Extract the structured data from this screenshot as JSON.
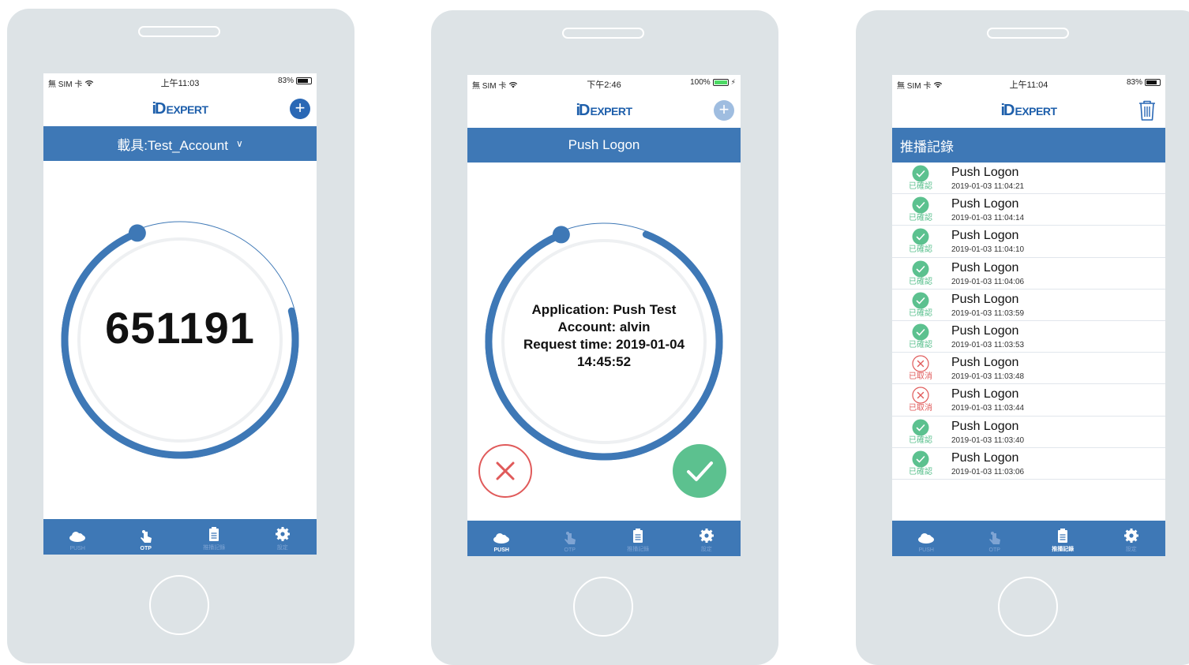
{
  "colors": {
    "brand": "#3e78b6",
    "approve": "#5cc18f",
    "reject": "#e05a5a"
  },
  "phones": [
    {
      "status": {
        "carrier": "無 SIM 卡",
        "time": "上午11:03",
        "battery": "83%"
      },
      "logo": {
        "mark": "iD",
        "text": "EXPERT"
      },
      "banner": "載具:Test_Account",
      "otp_code": "651191",
      "countdown_fraction": 0.73
    },
    {
      "status": {
        "carrier": "無 SIM 卡",
        "time": "下午2:46",
        "battery": "100%"
      },
      "logo": {
        "mark": "iD",
        "text": "EXPERT"
      },
      "banner": "Push Logon",
      "request": {
        "line1": "Application: Push Test",
        "line2": "Account: alvin",
        "line3": "Request time: 2019-01-04",
        "line4": "14:45:52"
      },
      "countdown_fraction": 0.88
    },
    {
      "status": {
        "carrier": "無 SIM 卡",
        "time": "上午11:04",
        "battery": "83%"
      },
      "logo": {
        "mark": "iD",
        "text": "EXPERT"
      },
      "banner": "推播記錄",
      "history": [
        {
          "status": "已確認",
          "ok": true,
          "title": "Push Logon",
          "time": "2019-01-03 11:04:21"
        },
        {
          "status": "已確認",
          "ok": true,
          "title": "Push Logon",
          "time": "2019-01-03 11:04:14"
        },
        {
          "status": "已確認",
          "ok": true,
          "title": "Push Logon",
          "time": "2019-01-03 11:04:10"
        },
        {
          "status": "已確認",
          "ok": true,
          "title": "Push Logon",
          "time": "2019-01-03 11:04:06"
        },
        {
          "status": "已確認",
          "ok": true,
          "title": "Push Logon",
          "time": "2019-01-03 11:03:59"
        },
        {
          "status": "已確認",
          "ok": true,
          "title": "Push Logon",
          "time": "2019-01-03 11:03:53"
        },
        {
          "status": "已取消",
          "ok": false,
          "title": "Push Logon",
          "time": "2019-01-03 11:03:48"
        },
        {
          "status": "已取消",
          "ok": false,
          "title": "Push Logon",
          "time": "2019-01-03 11:03:44"
        },
        {
          "status": "已確認",
          "ok": true,
          "title": "Push Logon",
          "time": "2019-01-03 11:03:40"
        },
        {
          "status": "已確認",
          "ok": true,
          "title": "Push Logon",
          "time": "2019-01-03 11:03:06"
        }
      ]
    }
  ],
  "tabs": [
    {
      "label": "PUSH",
      "icon": "cloud-icon"
    },
    {
      "label": "OTP",
      "icon": "touch-icon"
    },
    {
      "label": "推播記錄",
      "icon": "clipboard-icon"
    },
    {
      "label": "設定",
      "icon": "gear-icon"
    }
  ]
}
